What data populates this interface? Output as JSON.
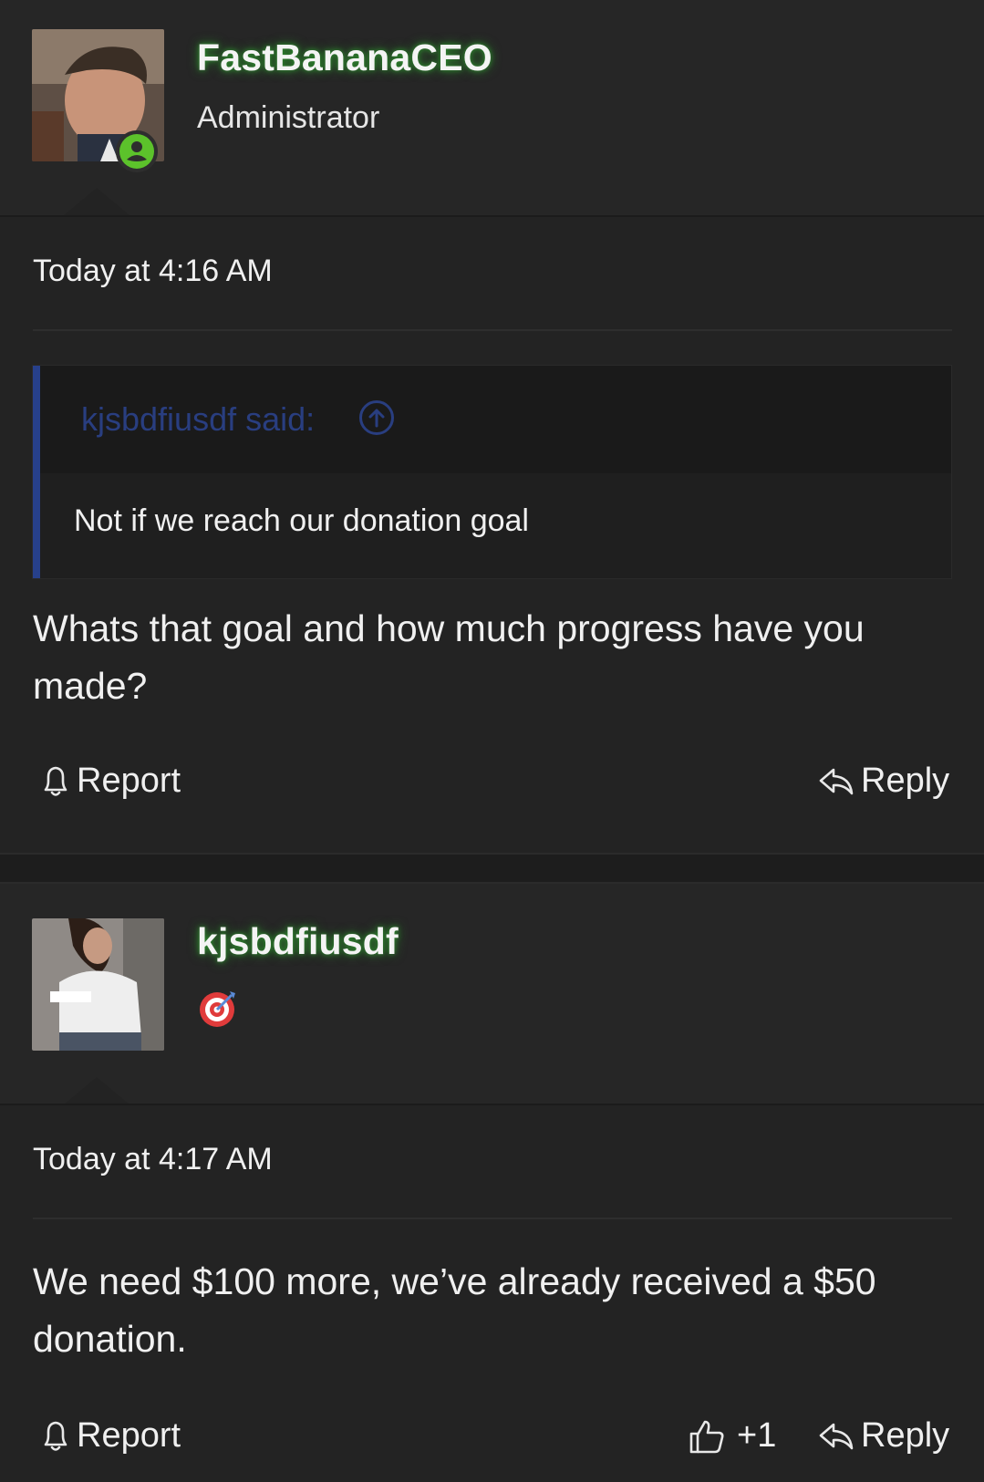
{
  "posts": [
    {
      "author": "FastBananaCEO",
      "user_title": "Administrator",
      "timestamp": "Today at 4:16 AM",
      "quote": {
        "author": "kjsbdfiusdf said:",
        "body": "Not if we reach our donation goal"
      },
      "message": "Whats that goal and how much progress have you made?",
      "actions": {
        "report": "Report",
        "reply": "Reply"
      }
    },
    {
      "author": "kjsbdfiusdf",
      "user_title": "",
      "timestamp": "Today at 4:17 AM",
      "message": "We need $100 more, we’ve already received a $50 donation.",
      "actions": {
        "report": "Report",
        "like_count": "+1",
        "reply": "Reply"
      }
    }
  ],
  "colors": {
    "background": "#222222",
    "username_glow": "#2f8f2f",
    "quote_accent": "#27408b",
    "online_green": "#5cc22b"
  },
  "icons": [
    "online-status-icon",
    "quote-jump-icon",
    "bell-icon",
    "reply-icon",
    "thumbs-up-icon",
    "target-emoji-icon"
  ]
}
